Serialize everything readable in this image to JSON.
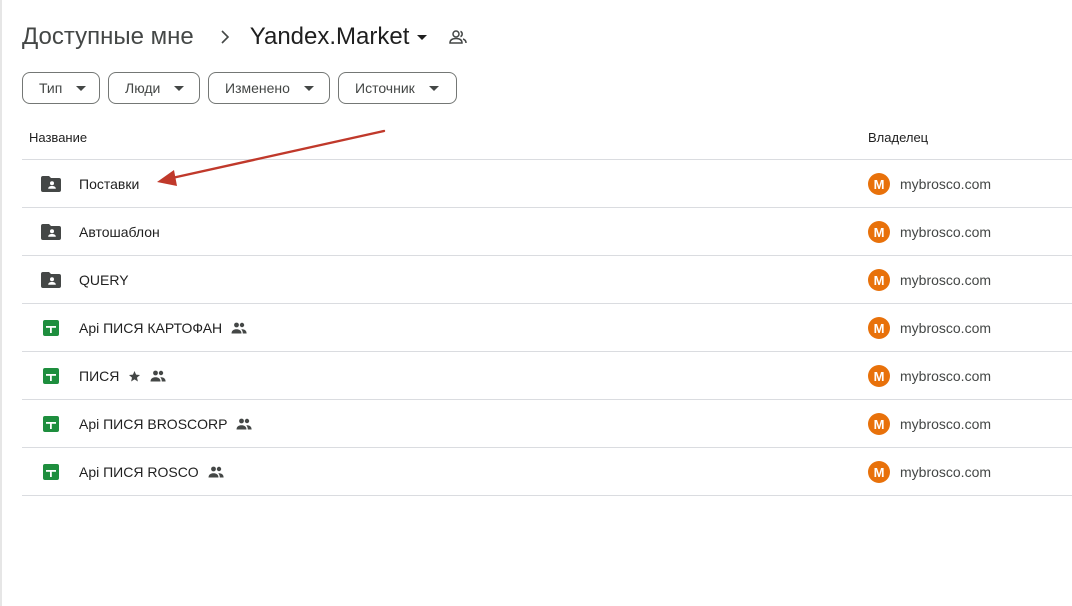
{
  "breadcrumb": {
    "root": "Доступные мне",
    "separator_icon": "chevron-right-icon",
    "current": "Yandex.Market",
    "shared_icon": "people-outline-icon"
  },
  "filters": [
    {
      "label": "Тип"
    },
    {
      "label": "Люди"
    },
    {
      "label": "Изменено"
    },
    {
      "label": "Источник"
    }
  ],
  "table": {
    "columns": {
      "name": "Название",
      "owner": "Владелец"
    },
    "rows": [
      {
        "name": "Поставки",
        "type": "shared-folder",
        "shared": false,
        "starred": false,
        "owner_initial": "M",
        "owner": "mybrosco.com"
      },
      {
        "name": "Автошаблон",
        "type": "shared-folder",
        "shared": false,
        "starred": false,
        "owner_initial": "M",
        "owner": "mybrosco.com"
      },
      {
        "name": "QUERY",
        "type": "shared-folder",
        "shared": false,
        "starred": false,
        "owner_initial": "M",
        "owner": "mybrosco.com"
      },
      {
        "name": "Api ПИСЯ КАРТОФАН",
        "type": "spreadsheet",
        "shared": true,
        "starred": false,
        "owner_initial": "M",
        "owner": "mybrosco.com"
      },
      {
        "name": "ПИСЯ",
        "type": "spreadsheet",
        "shared": true,
        "starred": true,
        "owner_initial": "M",
        "owner": "mybrosco.com"
      },
      {
        "name": "Api ПИСЯ BROSCORP",
        "type": "spreadsheet",
        "shared": true,
        "starred": false,
        "owner_initial": "M",
        "owner": "mybrosco.com"
      },
      {
        "name": "Api ПИСЯ ROSCO",
        "type": "spreadsheet",
        "shared": true,
        "starred": false,
        "owner_initial": "M",
        "owner": "mybrosco.com"
      }
    ]
  },
  "colors": {
    "folder": "#444746",
    "spreadsheet": "#1e8e3e",
    "avatar": "#e8710a",
    "annotation_arrow": "#c0392b",
    "divider": "#dadce0"
  },
  "annotation": {
    "type": "arrow",
    "points_to": "Поставки"
  }
}
